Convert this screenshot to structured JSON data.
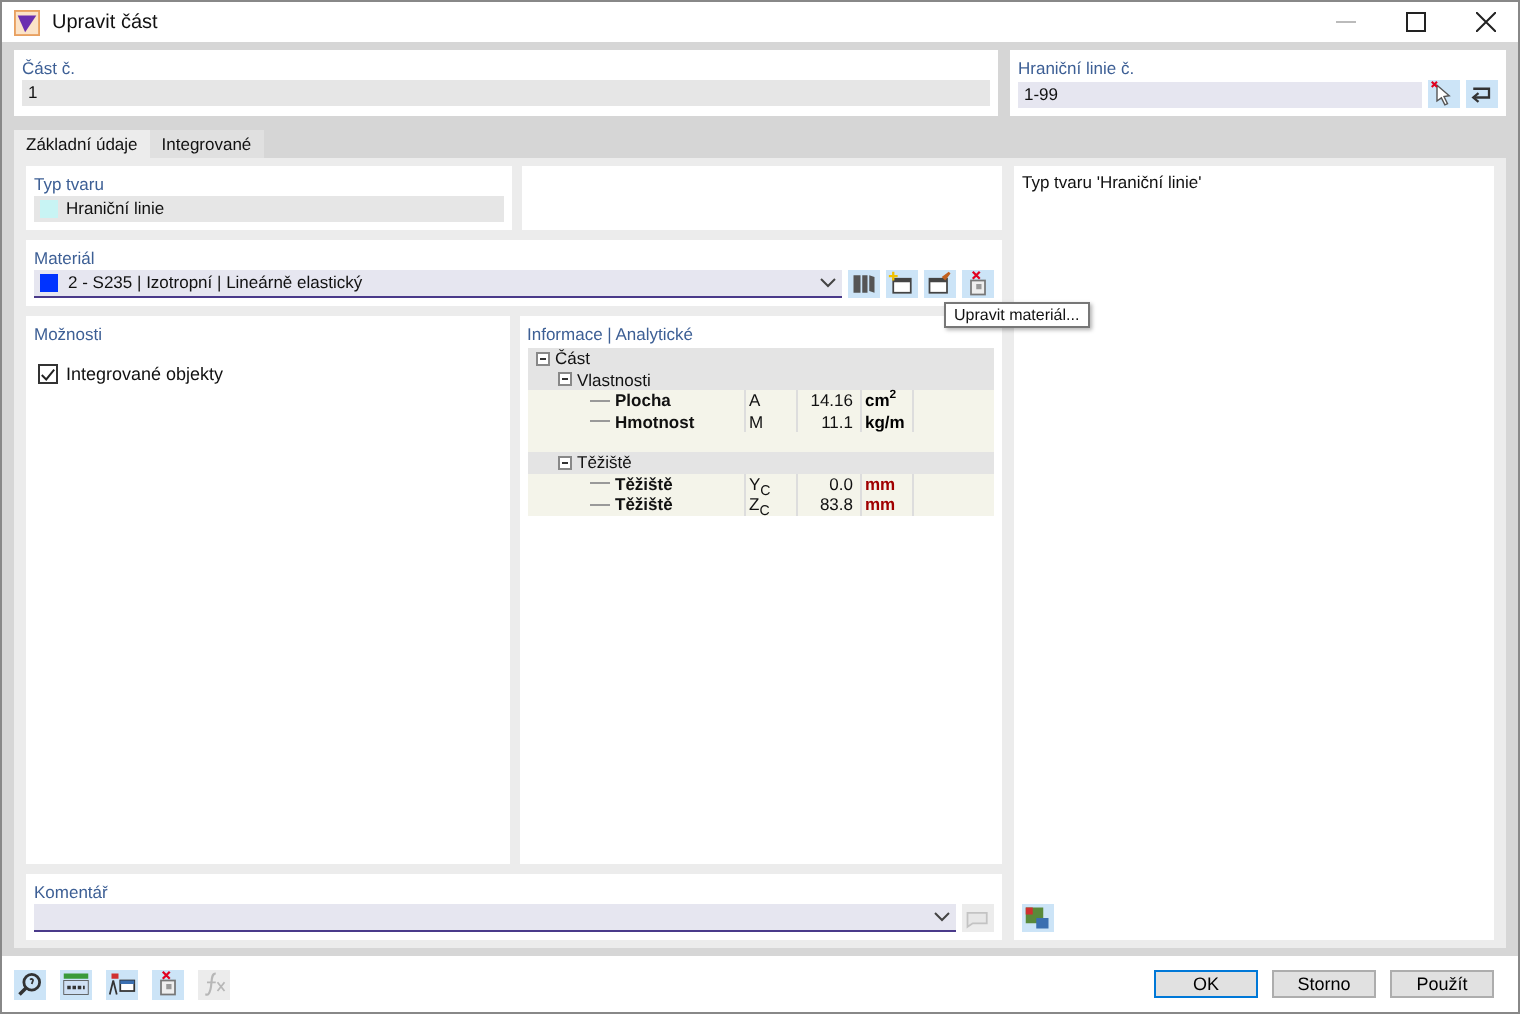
{
  "window": {
    "title": "Upravit část"
  },
  "part_no": {
    "label": "Část č.",
    "value": "1"
  },
  "boundary_lines": {
    "label": "Hraniční linie č.",
    "value": "1-99",
    "tools": [
      {
        "kind": "pick",
        "disabled": false
      },
      {
        "kind": "return",
        "disabled": false
      }
    ]
  },
  "tabs": [
    {
      "label": "Základní údaje",
      "selected": true
    },
    {
      "label": "Integrované",
      "selected": false
    }
  ],
  "shape_type": {
    "label": "Typ tvaru",
    "value": "Hraniční linie",
    "color": "#c8f4f4"
  },
  "material": {
    "label": "Materiál",
    "value": "2 - S235 | Izotropní | Lineárně elastický",
    "color": "#0033ff",
    "tools": [
      {
        "kind": "library",
        "disabled": false
      },
      {
        "kind": "new",
        "disabled": false
      },
      {
        "kind": "edit",
        "disabled": false
      },
      {
        "kind": "delete",
        "disabled": false
      }
    ]
  },
  "tooltip": "Upravit materiál...",
  "options": {
    "label": "Možnosti",
    "items": [
      {
        "label": "Integrované objekty",
        "checked": true
      }
    ]
  },
  "info": {
    "label": "Informace | Analytické",
    "tree": [
      {
        "label": "Část",
        "expanded": true,
        "children": [
          {
            "label": "Vlastnosti",
            "expanded": true,
            "children": [
              {
                "label": "Plocha",
                "symbol": "A",
                "value": "14.16",
                "unit": "cm$^{2}$",
                "color": "#000000"
              },
              {
                "label": "Hmotnost",
                "symbol": "M",
                "value": "11.1",
                "unit": "kg/m",
                "color": "#000000"
              }
            ]
          },
          {
            "label": "Těžiště",
            "expanded": true,
            "children": [
              {
                "label": "Těžiště",
                "symbol": "Y$_{C}$",
                "value": "0.0",
                "unit": "mm",
                "color": "#a00000"
              },
              {
                "label": "Těžiště",
                "symbol": "Z$_{C}$",
                "value": "83.8",
                "unit": "mm",
                "color": "#a00000"
              }
            ]
          }
        ]
      }
    ]
  },
  "comment": {
    "label": "Komentář",
    "tools": [
      {
        "kind": "comment",
        "disabled": true
      }
    ]
  },
  "preview": {
    "title": "Typ tvaru 'Hraniční linie'",
    "tools": [
      {
        "kind": "render",
        "disabled": false
      }
    ]
  },
  "toolbar": [
    {
      "kind": "search",
      "disabled": false
    },
    {
      "kind": "units",
      "disabled": false
    },
    {
      "kind": "display",
      "disabled": false
    },
    {
      "kind": "delete",
      "disabled": false
    },
    {
      "kind": "formula",
      "disabled": true
    }
  ],
  "buttons": [
    {
      "label": "OK",
      "default": true
    },
    {
      "label": "Storno",
      "default": false
    },
    {
      "label": "Použít",
      "default": false
    }
  ]
}
